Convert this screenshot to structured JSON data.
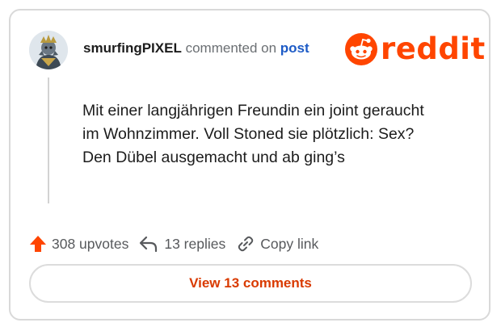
{
  "comment": {
    "author": "smurfingPIXEL",
    "commented_on": "commented on",
    "post_link": "post",
    "body_lines": [
      "Mit einer langjährigen Freundin ein joint geraucht",
      "im Wohnzimmer. Voll Stoned sie plötzlich: Sex?",
      "Den Dübel ausgemacht und ab ging’s"
    ]
  },
  "brand": {
    "name": "reddit",
    "color": "#ff4500"
  },
  "actions": {
    "upvotes": "308 upvotes",
    "replies": "13 replies",
    "copy_link": "Copy link"
  },
  "cta": {
    "label": "View 13 comments"
  },
  "icons": {
    "upvote": "upvote-arrow-icon",
    "reply": "reply-arrow-icon",
    "link": "chain-link-icon",
    "logo": "reddit-snoo-icon"
  },
  "colors": {
    "accent": "#ff4500",
    "link": "#1d5bc6",
    "cta_text": "#d93a00"
  }
}
